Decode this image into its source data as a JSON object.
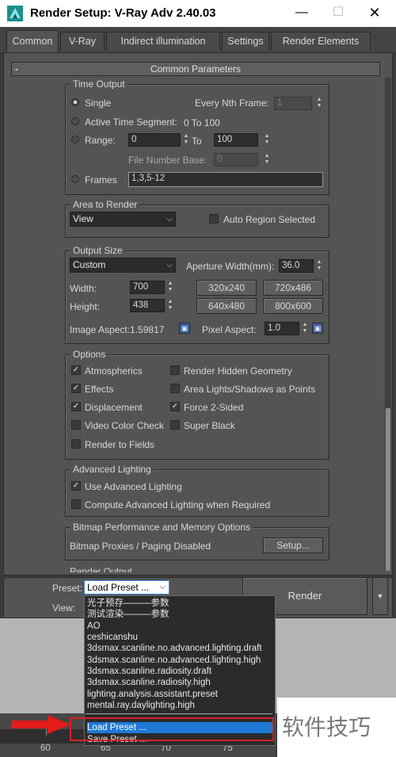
{
  "window": {
    "title": "Render Setup: V-Ray Adv 2.40.03",
    "minimize": "—",
    "maximize": "☐",
    "close": "✕"
  },
  "tabs": [
    {
      "label": "Common",
      "active": true
    },
    {
      "label": "V-Ray"
    },
    {
      "label": "Indirect illumination"
    },
    {
      "label": "Settings"
    },
    {
      "label": "Render Elements"
    }
  ],
  "rollout": {
    "minus": "-",
    "title": "Common Parameters"
  },
  "time_output": {
    "legend": "Time Output",
    "single": "Single",
    "every_nth_label": "Every Nth Frame:",
    "every_nth_value": "1",
    "active_segment": "Active Time Segment:",
    "active_segment_value": "0 To 100",
    "range": "Range:",
    "range_from": "0",
    "to": "To",
    "range_to": "100",
    "file_number_base": "File Number Base:",
    "file_number_value": "0",
    "frames": "Frames",
    "frames_value": "1,3,5-12"
  },
  "area_to_render": {
    "legend": "Area to Render",
    "value": "View",
    "auto_region": "Auto Region Selected"
  },
  "output_size": {
    "legend": "Output Size",
    "preset": "Custom",
    "aperture_label": "Aperture Width(mm):",
    "aperture_value": "36.0",
    "width_label": "Width:",
    "width_value": "700",
    "height_label": "Height:",
    "height_value": "438",
    "res_buttons": [
      "320x240",
      "720x486",
      "640x480",
      "800x600"
    ],
    "image_aspect": "Image Aspect:1.59817",
    "pixel_aspect_label": "Pixel Aspect:",
    "pixel_aspect_value": "1.0"
  },
  "options": {
    "legend": "Options",
    "left": [
      {
        "label": "Atmospherics",
        "checked": true
      },
      {
        "label": "Effects",
        "checked": true
      },
      {
        "label": "Displacement",
        "checked": true
      },
      {
        "label": "Video Color Check",
        "checked": false
      },
      {
        "label": "Render to Fields",
        "checked": false
      }
    ],
    "right": [
      {
        "label": "Render Hidden Geometry",
        "checked": false
      },
      {
        "label": "Area Lights/Shadows as Points",
        "checked": false
      },
      {
        "label": "Force 2-Sided",
        "checked": true
      },
      {
        "label": "Super Black",
        "checked": false
      }
    ]
  },
  "advanced_lighting": {
    "legend": "Advanced Lighting",
    "use": "Use Advanced Lighting",
    "compute": "Compute Advanced Lighting when Required"
  },
  "bitmap": {
    "legend": "Bitmap Performance and Memory Options",
    "status": "Bitmap Proxies / Paging Disabled",
    "setup": "Setup..."
  },
  "render_output_partial": "Render Output",
  "bottom": {
    "preset_label": "Preset:",
    "preset_value": "Load Preset ...",
    "view_label": "View:",
    "render": "Render"
  },
  "preset_list": [
    "光子预存———参数",
    "测试渲染———参数",
    "AO",
    "ceshicanshu",
    "3dsmax.scanline.no.advanced.lighting.draft",
    "3dsmax.scanline.no.advanced.lighting.high",
    "3dsmax.scanline.radiosity.draft",
    "3dsmax.scanline.radiosity.high",
    "lighting.analysis.assistant.preset",
    "mental.ray.daylighting.high",
    "Load Preset ...",
    "Save Preset ..."
  ],
  "timeline_ticks": [
    "60",
    "65",
    "70",
    "75"
  ],
  "watermark": "软件技巧",
  "colors": {
    "panel": "#545454",
    "highlight": "#1e7ad6",
    "annotation_red": "#d62222"
  }
}
